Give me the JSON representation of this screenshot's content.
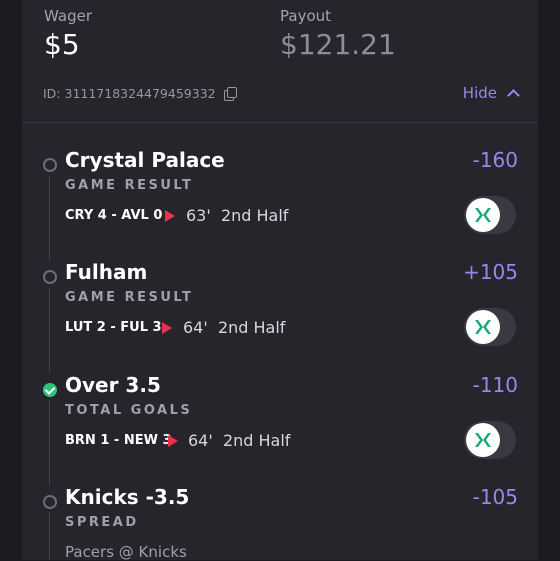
{
  "header": {
    "wager_label": "Wager",
    "wager_value": "$5",
    "payout_label": "Payout",
    "payout_value": "$121.21",
    "bet_id": "ID: 3111718324479459332",
    "hide_label": "Hide"
  },
  "legs": [
    {
      "selection": "Crystal Palace",
      "odds": "-160",
      "market": "GAME RESULT",
      "score": "CRY 4 - AVL 0",
      "minute": "63'",
      "period": "2nd Half",
      "status": "open"
    },
    {
      "selection": "Fulham",
      "odds": "+105",
      "market": "GAME RESULT",
      "score": "LUT 2 - FUL 3",
      "minute": "64'",
      "period": "2nd Half",
      "status": "open"
    },
    {
      "selection": "Over 3.5",
      "odds": "-110",
      "market": "TOTAL GOALS",
      "score": "BRN 1 - NEW 3",
      "minute": "64'",
      "period": "2nd Half",
      "status": "won"
    },
    {
      "selection": "Knicks -3.5",
      "odds": "-105",
      "market": "SPREAD",
      "matchup": "Pacers @ Knicks",
      "status": "open"
    }
  ],
  "colors": {
    "accent": "#9b85ee",
    "live": "#e8324a",
    "win": "#2ec27e",
    "toggle_mark": "#1aa97a"
  }
}
